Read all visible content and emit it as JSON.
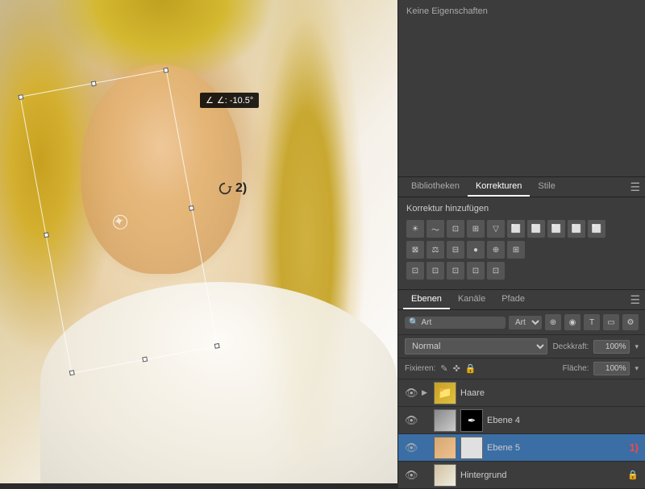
{
  "canvas": {
    "angle_label": "∠: -10.5°",
    "step_label": "2)"
  },
  "properties_panel": {
    "title": "Keine Eigenschaften"
  },
  "corrections_tabs": [
    {
      "label": "Bibliotheken",
      "active": false
    },
    {
      "label": "Korrekturen",
      "active": true
    },
    {
      "label": "Stile",
      "active": false
    }
  ],
  "corrections": {
    "title": "Korrektur hinzufügen",
    "icons_row1": [
      "☀",
      "≋",
      "⊡",
      "⊞",
      "▽",
      "",
      "",
      "",
      "",
      ""
    ],
    "icons_row2": [
      "⊠",
      "⚖",
      "⊟",
      "●",
      "⊕",
      "⊞"
    ],
    "icons_row3": [
      "⊡",
      "⊡",
      "⊡",
      "⊡",
      "⊡"
    ]
  },
  "layers_tabs": [
    {
      "label": "Ebenen",
      "active": true
    },
    {
      "label": "Kanäle",
      "active": false
    },
    {
      "label": "Pfade",
      "active": false
    }
  ],
  "layer_controls": {
    "search_placeholder": "Art",
    "type_default": "Art"
  },
  "blend_row": {
    "mode_label": "Normal",
    "opacity_label": "Deckkraft:",
    "opacity_value": "100%",
    "fill_label": "Fläche:",
    "fill_value": "100%"
  },
  "fix_row": {
    "label": "Fixieren:",
    "icons": [
      "✎",
      "✜",
      "🔒"
    ]
  },
  "layers": [
    {
      "id": "haare",
      "name": "Haare",
      "visible": true,
      "is_folder": true,
      "selected": false,
      "has_lock": false,
      "annotation": ""
    },
    {
      "id": "ebene4",
      "name": "Ebene 4",
      "visible": true,
      "is_folder": false,
      "selected": false,
      "has_lock": false,
      "annotation": "",
      "has_mask": true,
      "mask_type": "pen"
    },
    {
      "id": "ebene5",
      "name": "Ebene 5",
      "visible": true,
      "is_folder": false,
      "selected": true,
      "has_lock": false,
      "annotation": "1)",
      "has_mask": true,
      "mask_type": "white"
    },
    {
      "id": "hintergrund",
      "name": "Hintergrund",
      "visible": true,
      "is_folder": false,
      "selected": false,
      "has_lock": true,
      "annotation": ""
    }
  ]
}
